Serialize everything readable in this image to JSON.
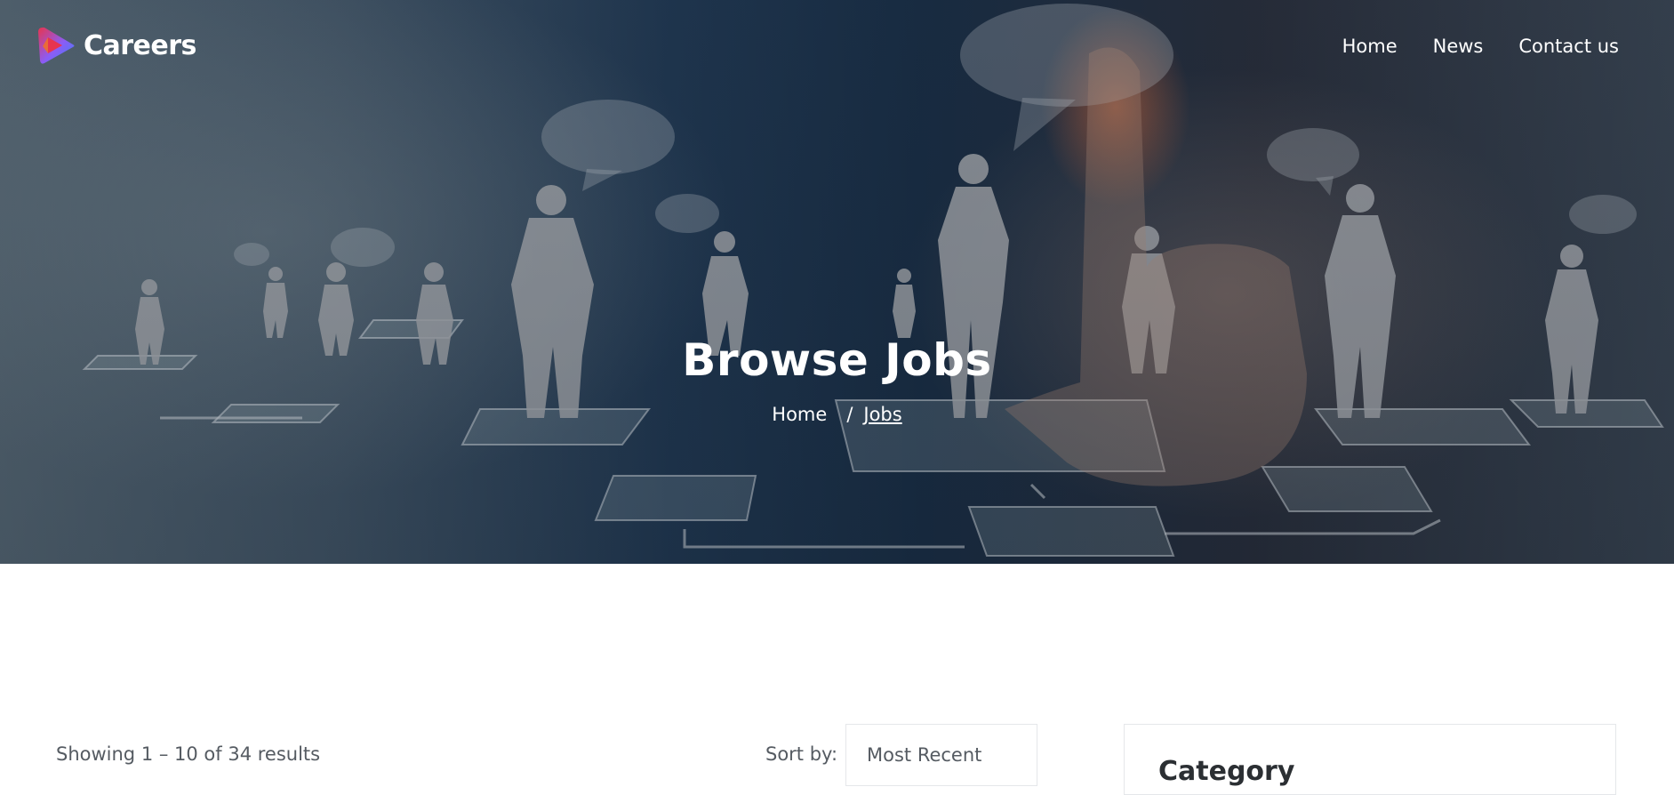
{
  "brand": {
    "name": "Careers",
    "logo_icon": "play-logo-icon"
  },
  "nav": {
    "items": [
      {
        "label": "Home"
      },
      {
        "label": "News"
      },
      {
        "label": "Contact us"
      }
    ]
  },
  "hero": {
    "title": "Browse Jobs",
    "breadcrumb": {
      "home": "Home",
      "separator": "/",
      "current": "Jobs"
    }
  },
  "listing": {
    "results_text": "Showing 1 – 10 of 34 results",
    "sort_label": "Sort by:",
    "sort_selected": "Most Recent"
  },
  "sidebar": {
    "category_title": "Category"
  },
  "colors": {
    "text_muted": "#555b62",
    "border": "#e5e7ea",
    "heading": "#2b2f33",
    "logo_red": "#e8344e",
    "logo_blue": "#3b82f6"
  }
}
